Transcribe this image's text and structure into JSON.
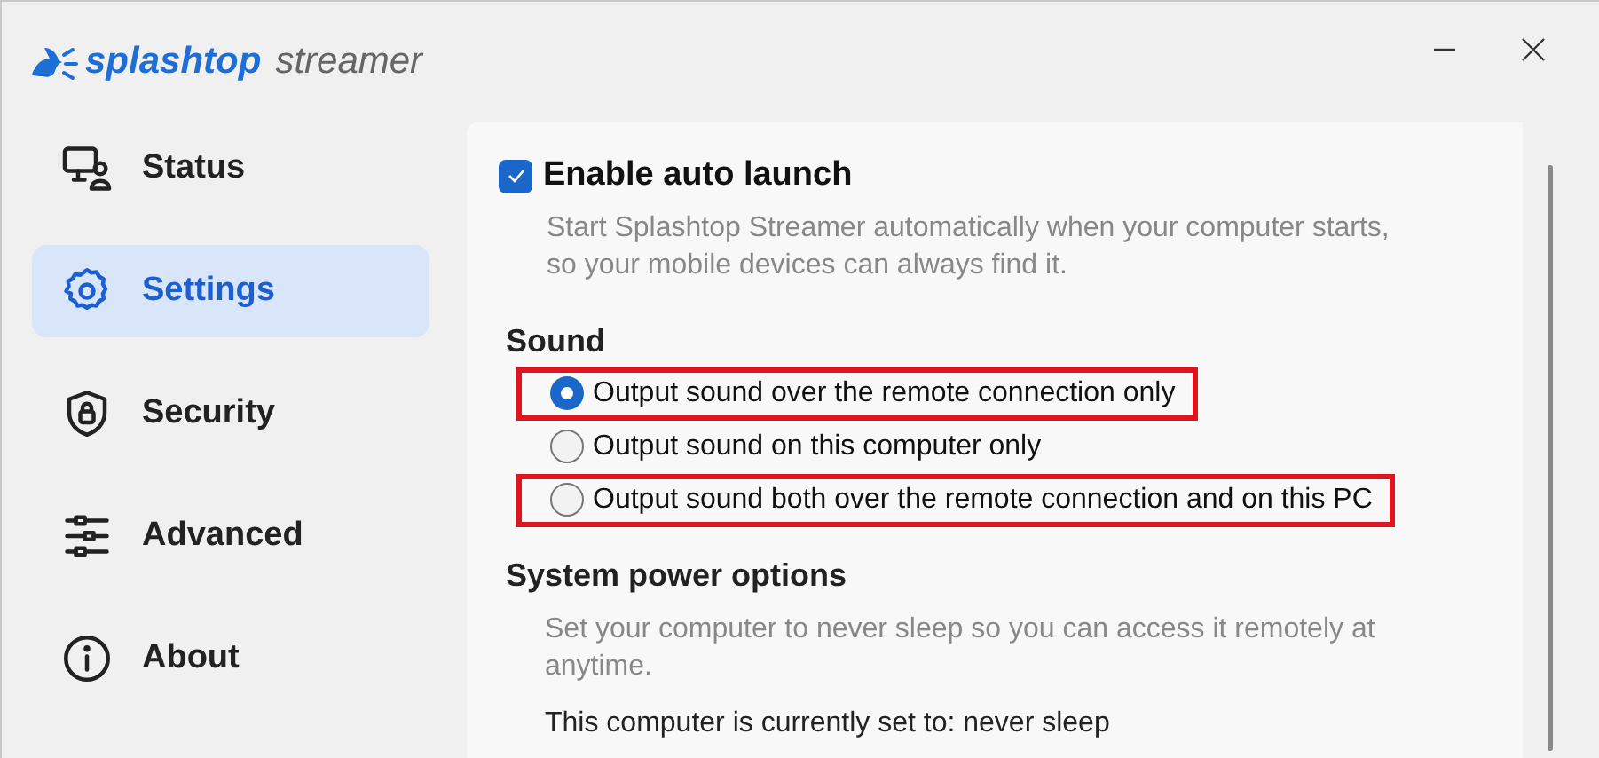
{
  "app": {
    "brand": "splashtop",
    "product": "streamer"
  },
  "sidebar": {
    "items": [
      {
        "label": "Status",
        "selected": false
      },
      {
        "label": "Settings",
        "selected": true
      },
      {
        "label": "Security",
        "selected": false
      },
      {
        "label": "Advanced",
        "selected": false
      },
      {
        "label": "About",
        "selected": false
      }
    ]
  },
  "auto_launch": {
    "label": "Enable auto launch",
    "checked": true,
    "description": "Start Splashtop Streamer automatically when your computer starts, so your mobile devices can always find it."
  },
  "sound": {
    "heading": "Sound",
    "options": [
      {
        "label": "Output sound over the remote connection only",
        "selected": true,
        "highlighted": true
      },
      {
        "label": "Output sound on this computer only",
        "selected": false,
        "highlighted": false
      },
      {
        "label": "Output sound both over the remote connection and on this PC",
        "selected": false,
        "highlighted": true
      }
    ]
  },
  "power": {
    "heading": "System power options",
    "description": "Set your computer to never sleep so you can access it remotely at anytime.",
    "status": "This computer is currently set to: never sleep"
  }
}
